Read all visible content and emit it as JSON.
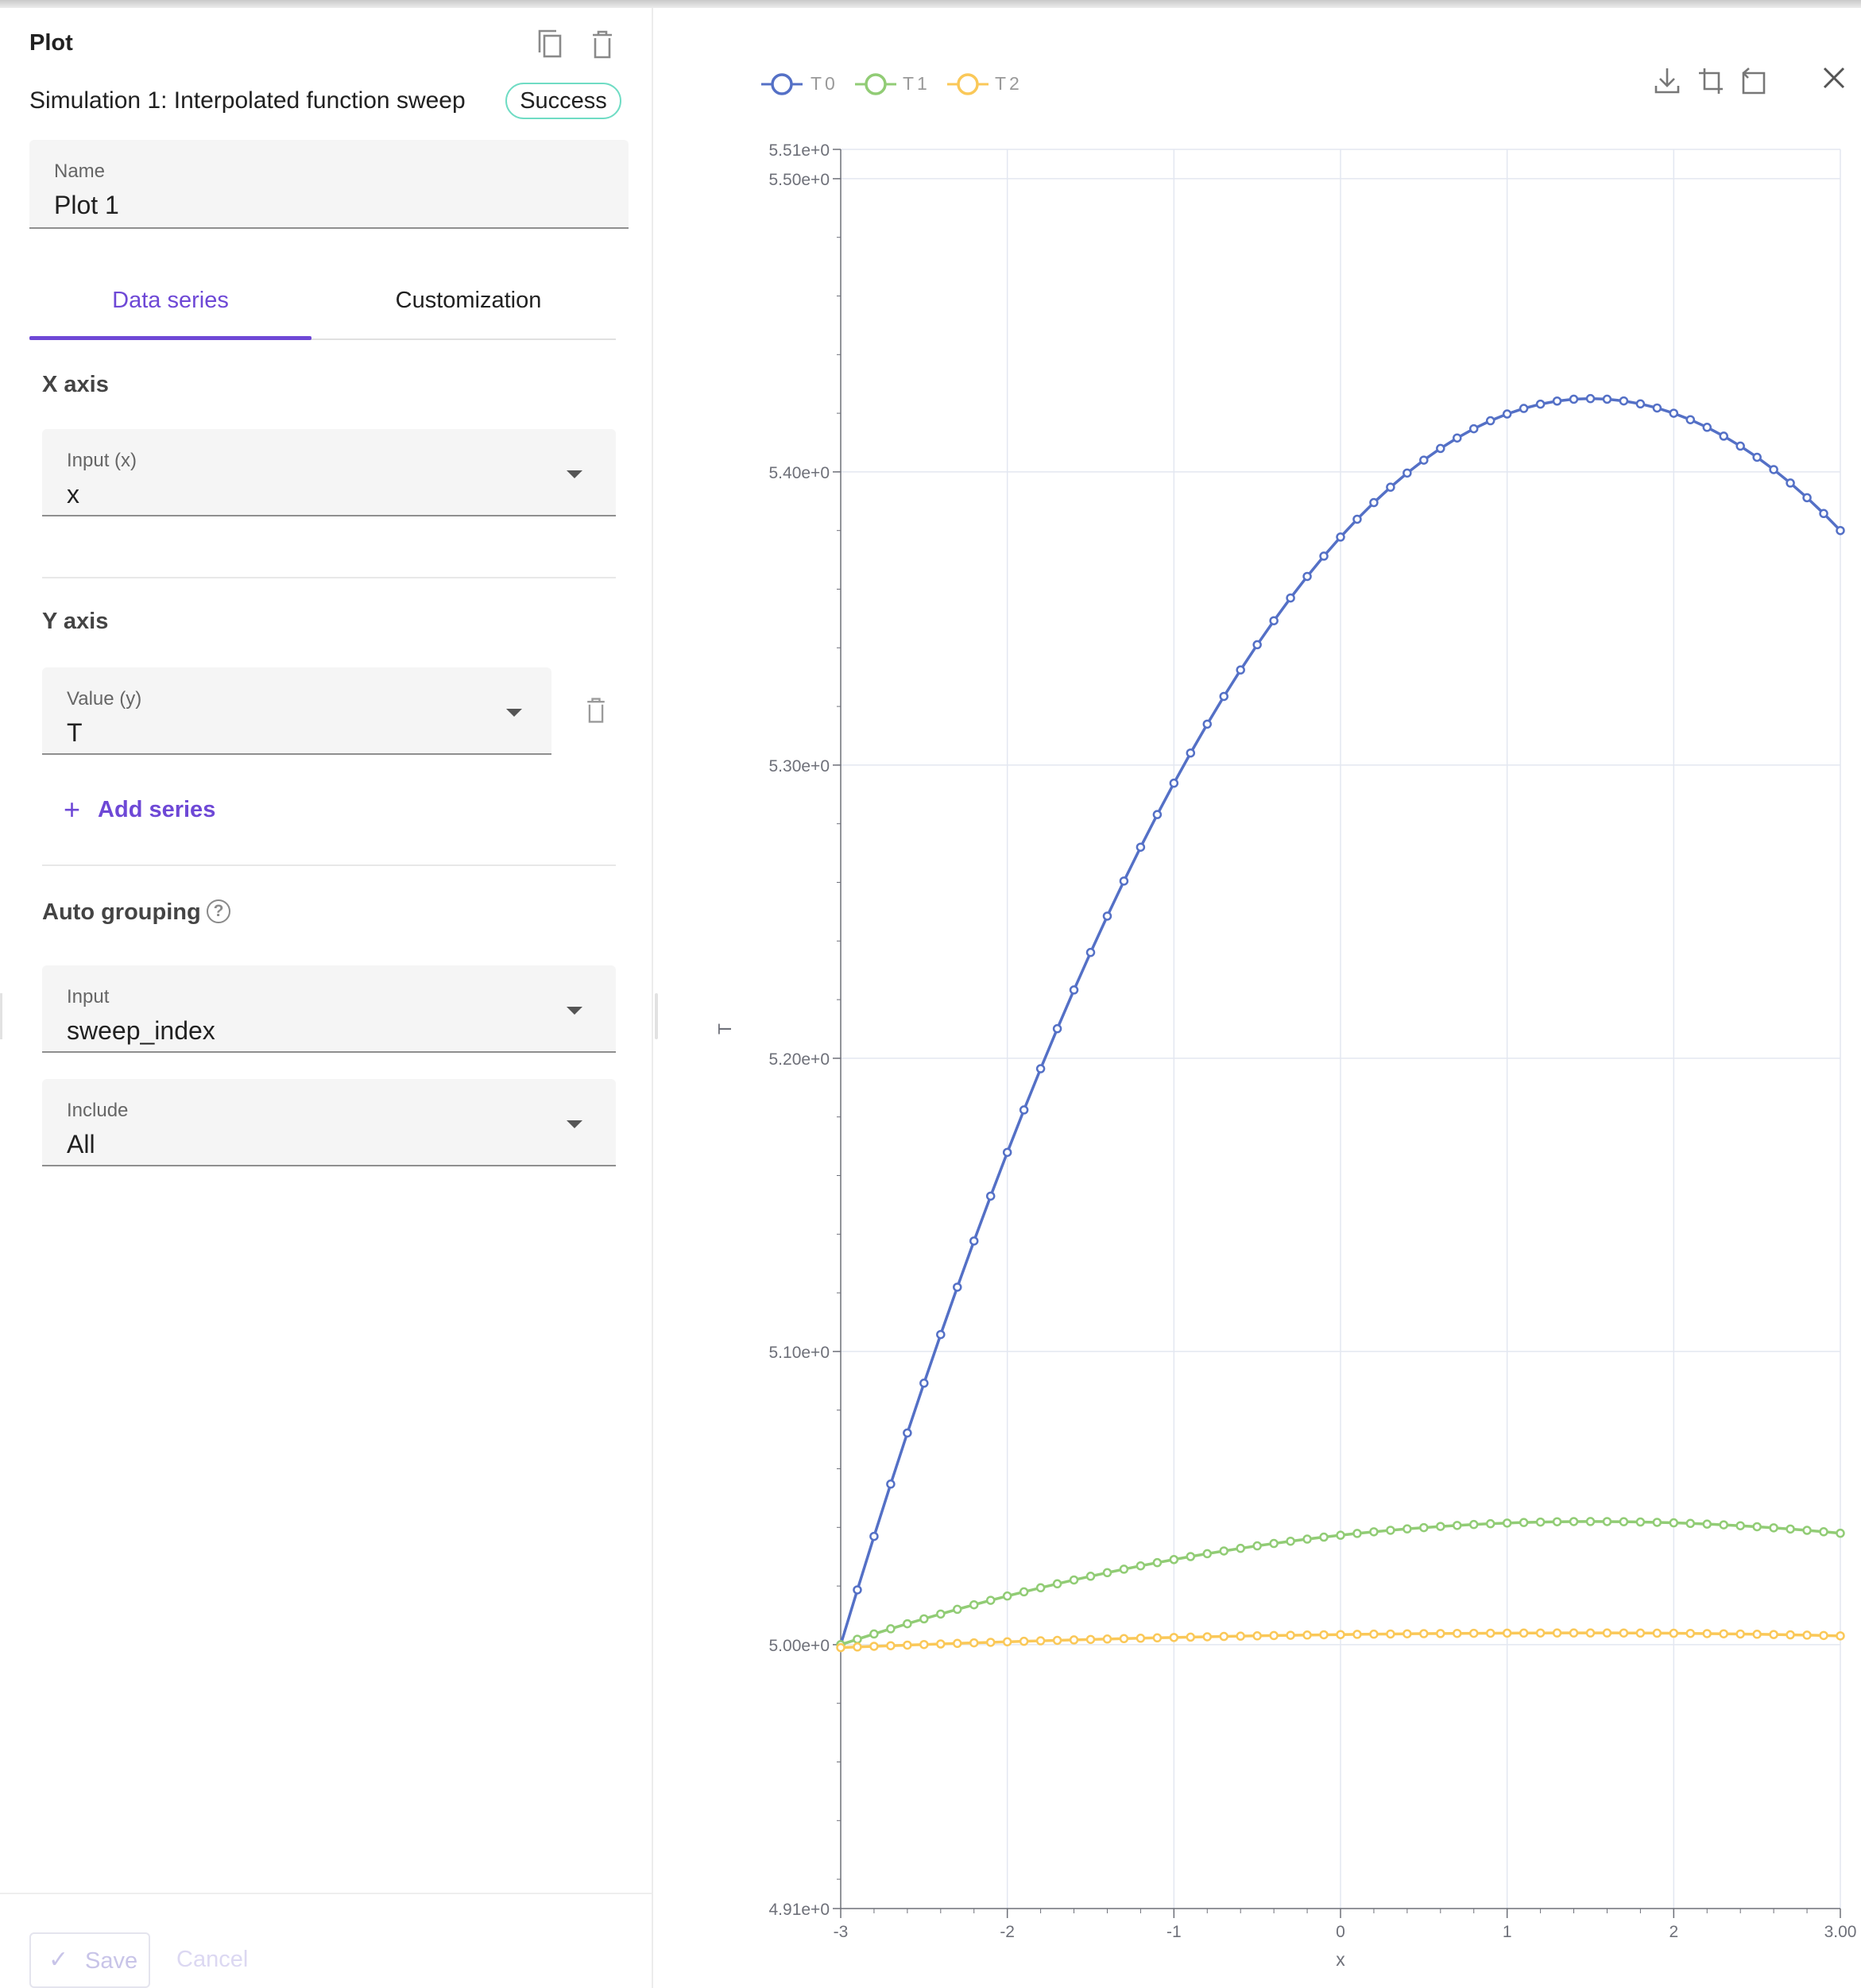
{
  "panel": {
    "title": "Plot",
    "simulation_name": "Simulation 1: Interpolated function sweep",
    "status": "Success",
    "name_field": {
      "label": "Name",
      "value": "Plot 1"
    },
    "tabs": [
      {
        "label": "Data series",
        "active": true
      },
      {
        "label": "Customization",
        "active": false
      }
    ],
    "x_axis": {
      "heading": "X axis",
      "label": "Input (x)",
      "value": "x"
    },
    "y_axis": {
      "heading": "Y axis",
      "label": "Value (y)",
      "value": "T"
    },
    "add_series": "Add series",
    "auto_grouping": {
      "heading": "Auto grouping",
      "input": {
        "label": "Input",
        "value": "sweep_index"
      },
      "include": {
        "label": "Include",
        "value": "All"
      }
    },
    "footer": {
      "save": "Save",
      "cancel": "Cancel"
    }
  },
  "toolbar_icons": [
    "download-icon",
    "crop-icon",
    "restore-icon",
    "close-icon"
  ],
  "colors": {
    "accent": "#6e48d6",
    "success": "#6fdcc4",
    "T0": "#5470c6",
    "T1": "#91cc75",
    "T2": "#fac858"
  },
  "chart_data": {
    "type": "line",
    "title": "",
    "xlabel": "x",
    "ylabel": "T",
    "xlim": [
      -3,
      3
    ],
    "ylim": [
      4.91,
      5.51
    ],
    "x_ticks": [
      "-3",
      "-2",
      "-1",
      "0",
      "1",
      "2",
      "3.00"
    ],
    "y_ticks": [
      "4.91e+0",
      "5.00e+0",
      "5.10e+0",
      "5.20e+0",
      "5.30e+0",
      "5.40e+0",
      "5.50e+0",
      "5.51e+0"
    ],
    "grid": true,
    "legend_position": "top-left",
    "series": [
      {
        "name": "T0",
        "peak_x": 1.5,
        "peak_y": 5.425,
        "start": [
          -3,
          5.0
        ],
        "end": [
          3,
          5.38
        ]
      },
      {
        "name": "T1",
        "peak_x": 1.5,
        "peak_y": 5.042,
        "start": [
          -3,
          5.0
        ],
        "end": [
          3,
          5.038
        ]
      },
      {
        "name": "T2",
        "peak_x": 1.5,
        "peak_y": 5.004,
        "start": [
          -3,
          4.999
        ],
        "end": [
          3,
          5.003
        ]
      }
    ]
  }
}
